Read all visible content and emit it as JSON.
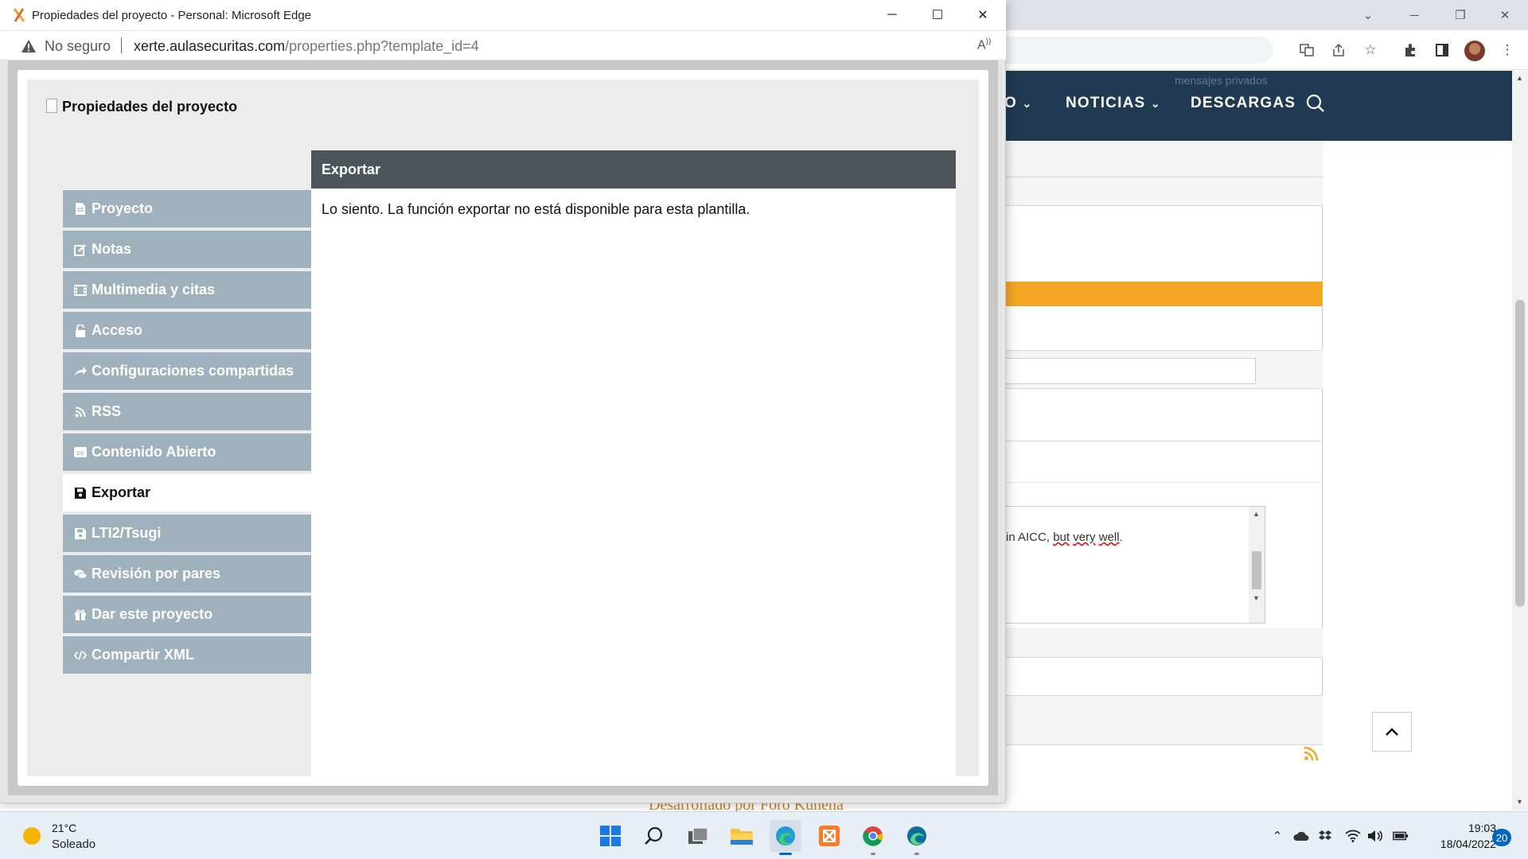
{
  "popup": {
    "window_title": "Propiedades del proyecto - Personal: Microsoft Edge",
    "address": {
      "security_label": "No seguro",
      "host": "xerte.aulasecuritas.com",
      "path": "/properties.php?template_id=4"
    },
    "dialog_title": "Propiedades del proyecto",
    "tabs": [
      {
        "label": "Proyecto",
        "icon": "file-icon"
      },
      {
        "label": "Notas",
        "icon": "edit-icon"
      },
      {
        "label": "Multimedia y citas",
        "icon": "film-icon"
      },
      {
        "label": "Acceso",
        "icon": "unlock-icon"
      },
      {
        "label": "Configuraciones compartidas",
        "icon": "share-icon"
      },
      {
        "label": "RSS",
        "icon": "rss-icon"
      },
      {
        "label": "Contenido Abierto",
        "icon": "cc-icon"
      },
      {
        "label": "Exportar",
        "icon": "save-icon"
      },
      {
        "label": "LTI2/Tsugi",
        "icon": "save-icon"
      },
      {
        "label": "Revisión por pares",
        "icon": "comments-icon"
      },
      {
        "label": "Dar este proyecto",
        "icon": "gift-icon"
      },
      {
        "label": "Compartir XML",
        "icon": "code-icon"
      }
    ],
    "active_tab": "Exportar",
    "panel": {
      "heading": "Exportar",
      "message": "Lo siento. La función exportar no está disponible para esta plantilla."
    }
  },
  "background": {
    "nav": {
      "partial_item": "O",
      "items": [
        "NOTICIAS",
        "DESCARGAS"
      ],
      "faint_text": "mensajes privados"
    },
    "textarea_text": {
      "before": "in AICC, ",
      "w1": "but",
      "w2": "very",
      "w3": "well",
      "after": "."
    },
    "footer_text": "Desarrollado por Foro Kunena"
  },
  "taskbar": {
    "weather": {
      "temp": "21°C",
      "condition": "Soleado"
    },
    "clock": {
      "time": "19:03",
      "date": "18/04/2022"
    },
    "notification_count": "20"
  },
  "colors": {
    "nav_bg": "#1f3a52",
    "tab_bg": "#9fb1bc",
    "panel_head_bg": "#4d555b",
    "accent_orange": "#f5a623"
  }
}
